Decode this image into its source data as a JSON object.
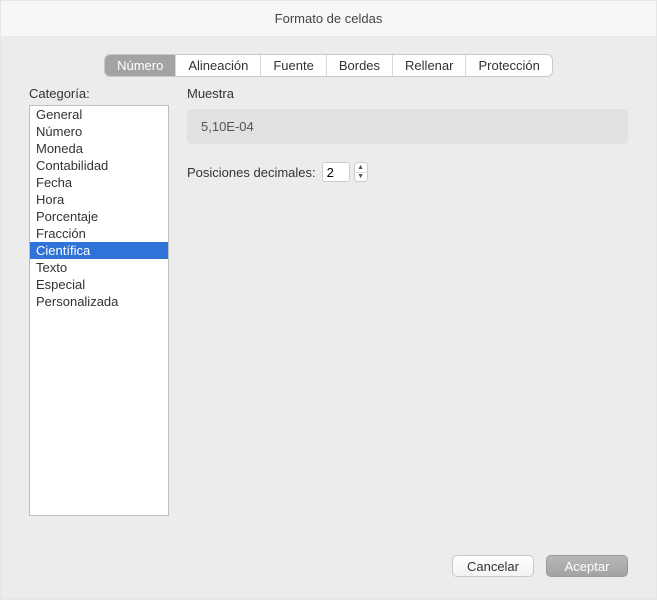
{
  "window": {
    "title": "Formato de celdas"
  },
  "tabs": [
    {
      "label": "Número",
      "selected": true
    },
    {
      "label": "Alineación",
      "selected": false
    },
    {
      "label": "Fuente",
      "selected": false
    },
    {
      "label": "Bordes",
      "selected": false
    },
    {
      "label": "Rellenar",
      "selected": false
    },
    {
      "label": "Protección",
      "selected": false
    }
  ],
  "category": {
    "label": "Categoría:",
    "items": [
      {
        "label": "General",
        "selected": false
      },
      {
        "label": "Número",
        "selected": false
      },
      {
        "label": "Moneda",
        "selected": false
      },
      {
        "label": "Contabilidad",
        "selected": false
      },
      {
        "label": "Fecha",
        "selected": false
      },
      {
        "label": "Hora",
        "selected": false
      },
      {
        "label": "Porcentaje",
        "selected": false
      },
      {
        "label": "Fracción",
        "selected": false
      },
      {
        "label": "Científica",
        "selected": true
      },
      {
        "label": "Texto",
        "selected": false
      },
      {
        "label": "Especial",
        "selected": false
      },
      {
        "label": "Personalizada",
        "selected": false
      }
    ]
  },
  "sample": {
    "label": "Muestra",
    "value": "5,10E-04"
  },
  "decimals": {
    "label": "Posiciones decimales:",
    "value": "2"
  },
  "footer": {
    "cancel": "Cancelar",
    "ok": "Aceptar"
  }
}
